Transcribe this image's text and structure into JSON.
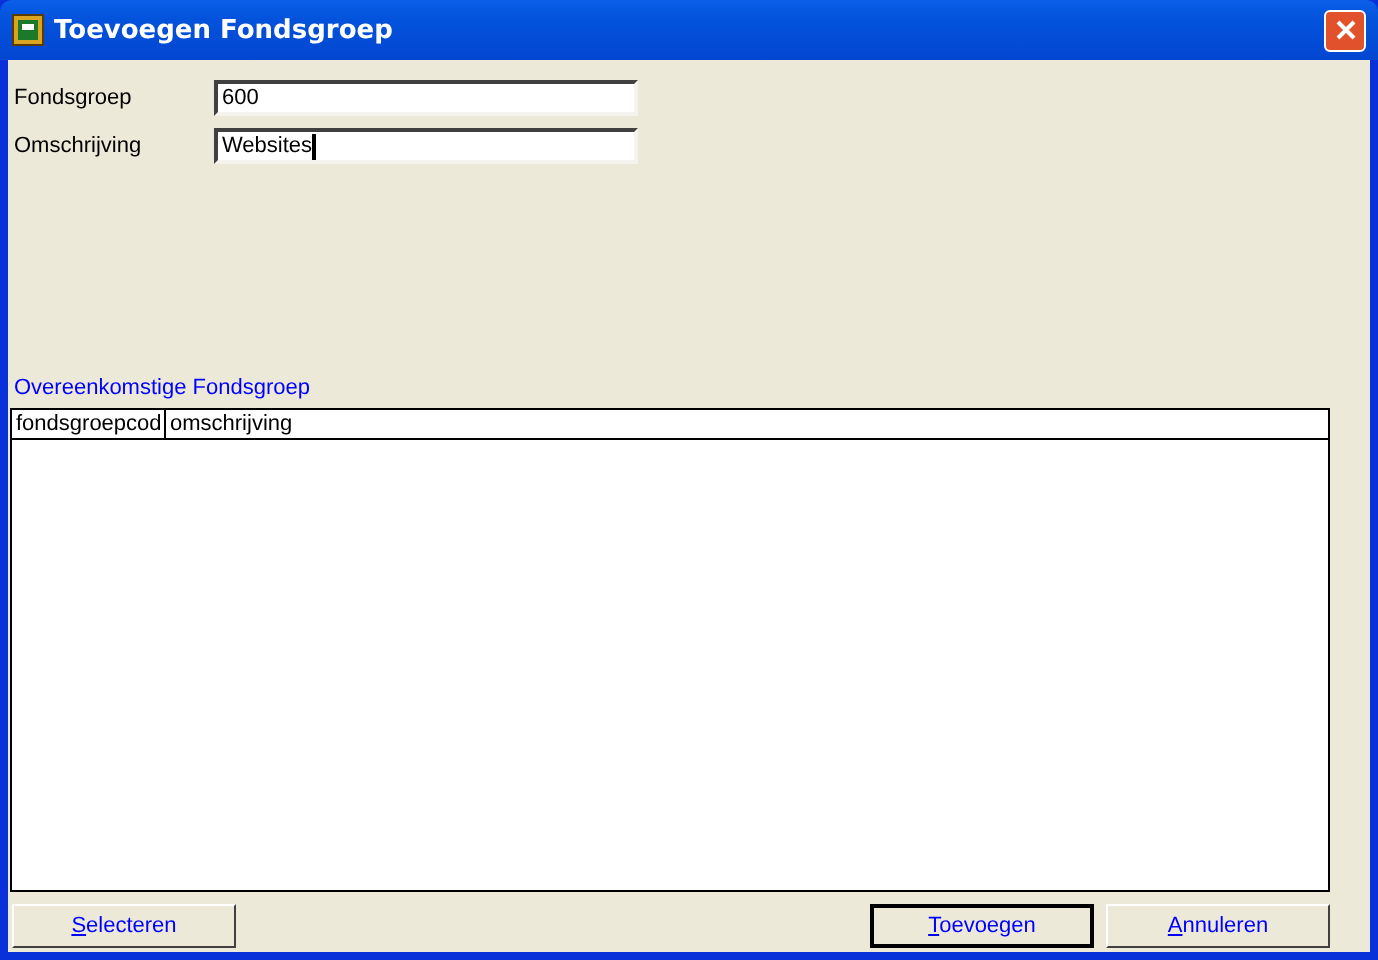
{
  "window": {
    "title": "Toevoegen Fondsgroep"
  },
  "fields": [
    {
      "label": "Fondsgroep",
      "value": "600",
      "focused": false
    },
    {
      "label": "Omschrijving",
      "value": "Websites",
      "focused": true
    }
  ],
  "matches": {
    "title": "Overeenkomstige Fondsgroep",
    "columns": [
      "fondsgroepcod",
      "omschrijving"
    ]
  },
  "buttons": [
    {
      "label": "Selecteren",
      "default": false,
      "underline_first": true
    },
    {
      "label": "Toevoegen",
      "default": true,
      "underline_first": true
    },
    {
      "label": "Annuleren",
      "default": false,
      "underline_first": true
    }
  ]
}
